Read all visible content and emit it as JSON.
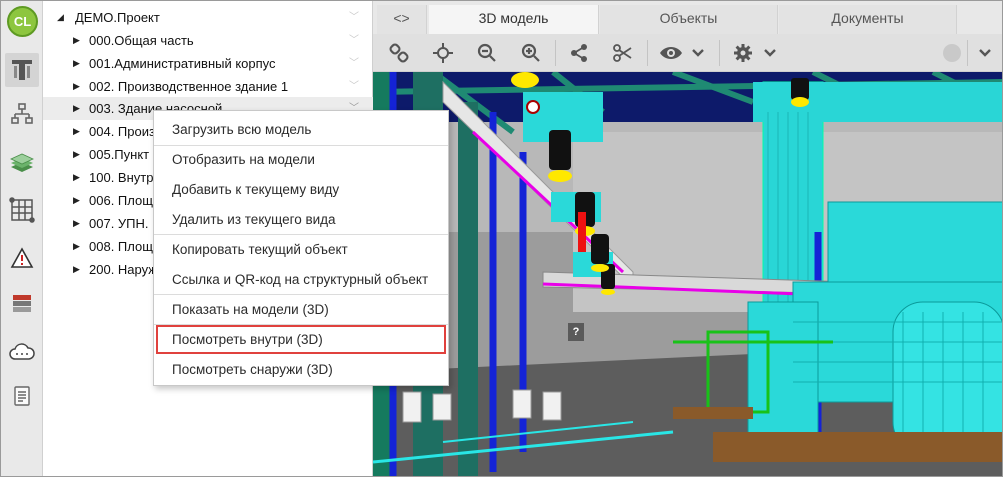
{
  "logo": {
    "text": "CL"
  },
  "rail": {
    "icons": [
      "structure-icon",
      "hierarchy-icon",
      "layers-icon",
      "network-icon",
      "warning-icon",
      "table-icon",
      "cloud-icon",
      "document-icon"
    ]
  },
  "tree": {
    "root": {
      "label": "ДЕМО.Проект"
    },
    "items": [
      {
        "label": "000.Общая часть"
      },
      {
        "label": "001.Административный корпус"
      },
      {
        "label": "002. Производственное здание 1"
      },
      {
        "label": "003. Здание насосной"
      },
      {
        "label": "004. Произ"
      },
      {
        "label": "005.Пункт"
      },
      {
        "label": "100. Внутр"
      },
      {
        "label": "006. Площ"
      },
      {
        "label": "007. УПН."
      },
      {
        "label": "008. Площ"
      },
      {
        "label": "200. Наруж"
      }
    ]
  },
  "tabs": {
    "toggle": "<>",
    "items": [
      {
        "label": "3D модель"
      },
      {
        "label": "Объекты"
      },
      {
        "label": "Документы"
      }
    ]
  },
  "toolbar": {
    "icons": [
      "link-icon",
      "move-icon",
      "zoom-out-icon",
      "zoom-in-icon",
      "share-icon",
      "scissors-icon",
      "eye-icon",
      "chevron-down-icon",
      "gear-icon",
      "chevron-down-icon"
    ]
  },
  "viewport": {
    "help_marker": "?"
  },
  "menu": {
    "items": [
      {
        "label": "Загрузить всю модель"
      },
      {
        "label": "Отобразить на модели"
      },
      {
        "label": "Добавить к текущему виду"
      },
      {
        "label": "Удалить из текущего вида"
      },
      {
        "label": "Копировать текущий объект"
      },
      {
        "label": "Ссылка и QR-код на структурный объект"
      },
      {
        "label": "Показать на модели (3D)"
      },
      {
        "label": "Посмотреть внутри (3D)"
      },
      {
        "label": "Посмотреть снаружи (3D)"
      }
    ],
    "highlight_color": "#e0413d"
  },
  "colors": {
    "accent": "#8dc63f",
    "cyan": "#00e5e5",
    "steel_green": "#1c7a6a",
    "yellow": "#ffe800"
  }
}
